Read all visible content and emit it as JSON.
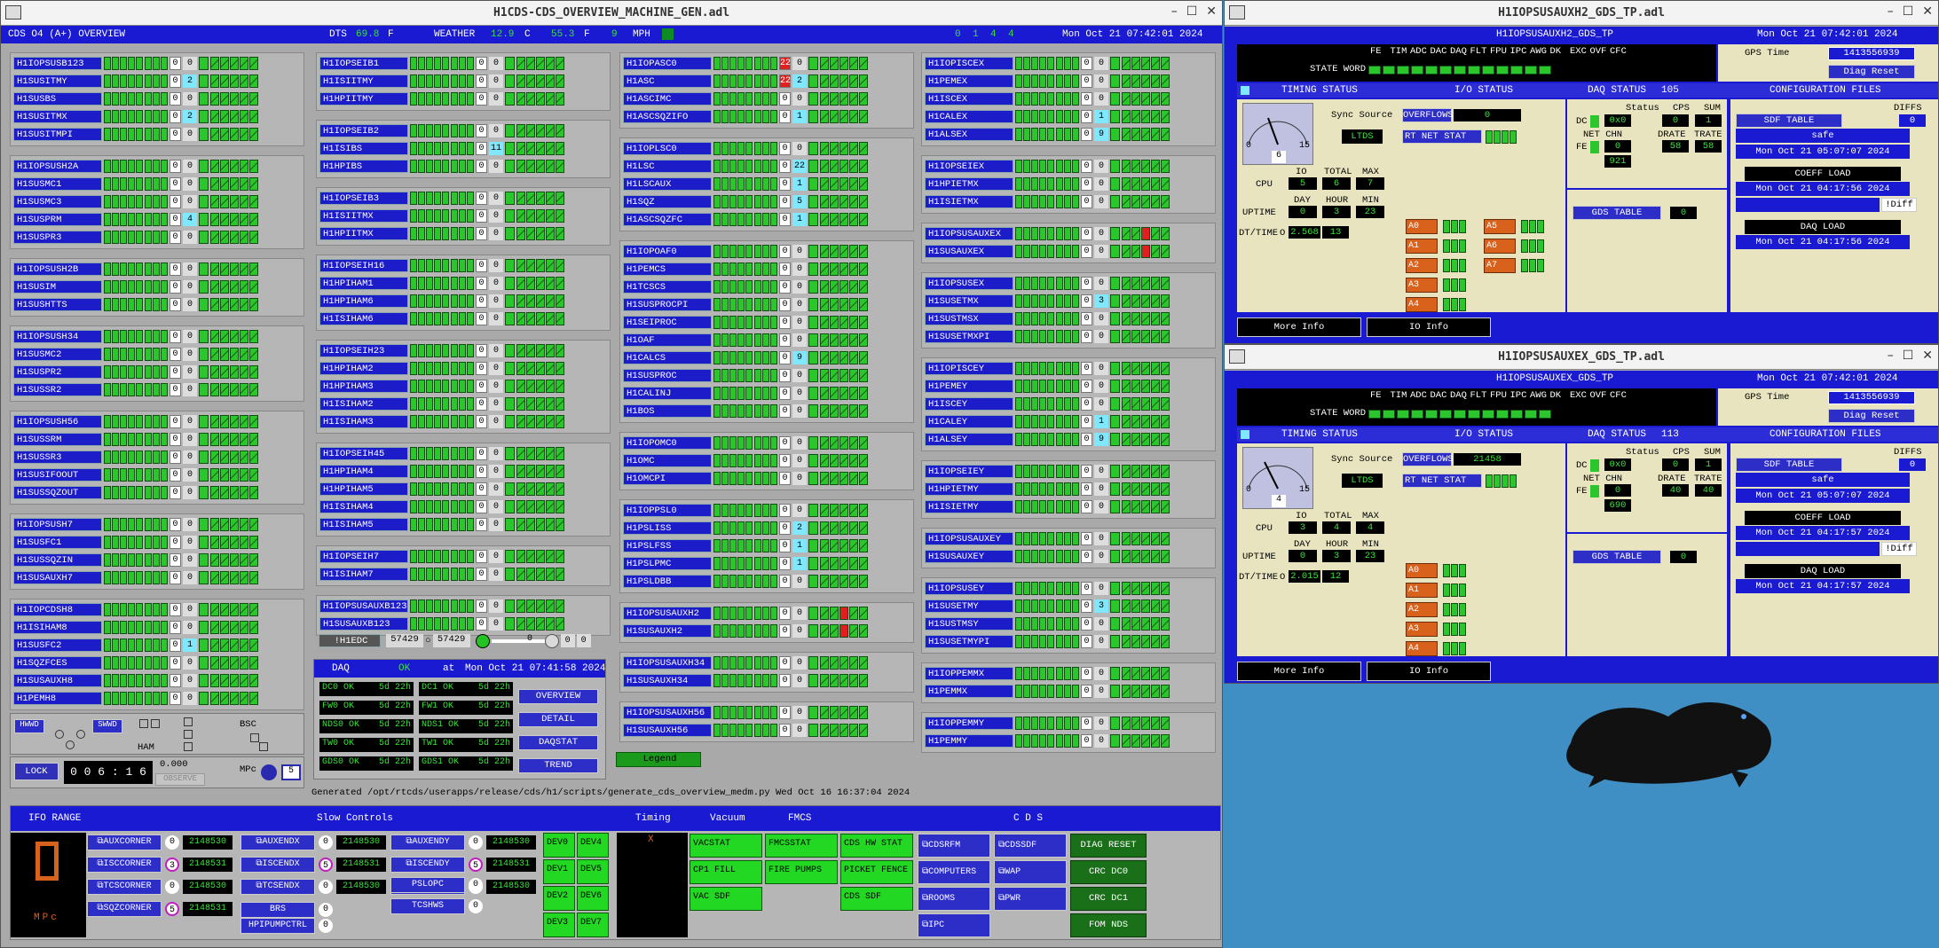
{
  "main": {
    "title": "H1CDS-CDS_OVERVIEW_MACHINE_GEN.adl",
    "header": {
      "left": "CDS O4 (A+) OVERVIEW",
      "dts_label": "DTS",
      "dts_val": "69.8",
      "dts_unit": "F",
      "weather_label": "WEATHER",
      "w1": "12.9",
      "w1u": "C",
      "w2": "55.3",
      "w2u": "F",
      "w3": "9",
      "w3u": "MPH",
      "nums": [
        "0",
        "1",
        "4",
        "4"
      ],
      "time": "Mon Oct 21 07:42:01 2024"
    },
    "col1": [
      [
        {
          "l": "H1IOPSUSB123",
          "v": "0"
        },
        {
          "l": "H1SUSITMY",
          "v": "2",
          "h": true
        },
        {
          "l": "H1SUSBS",
          "v": "0"
        },
        {
          "l": "H1SUSITMX",
          "v": "2",
          "h": true
        },
        {
          "l": "H1SUSITMPI",
          "v": "0"
        }
      ],
      [
        {
          "l": "H1IOPSUSH2A",
          "v": "0"
        },
        {
          "l": "H1SUSMC1",
          "v": "0"
        },
        {
          "l": "H1SUSMC3",
          "v": "0"
        },
        {
          "l": "H1SUSPRM",
          "v": "4",
          "h": true
        },
        {
          "l": "H1SUSPR3",
          "v": "0"
        }
      ],
      [
        {
          "l": "H1IOPSUSH2B",
          "v": "0"
        },
        {
          "l": "H1SUSIM",
          "v": "0"
        },
        {
          "l": "H1SUSHTTS",
          "v": "0"
        }
      ],
      [
        {
          "l": "H1IOPSUSH34",
          "v": "0"
        },
        {
          "l": "H1SUSMC2",
          "v": "0"
        },
        {
          "l": "H1SUSPR2",
          "v": "0"
        },
        {
          "l": "H1SUSSR2",
          "v": "0"
        }
      ],
      [
        {
          "l": "H1IOPSUSH56",
          "v": "0"
        },
        {
          "l": "H1SUSSRM",
          "v": "0"
        },
        {
          "l": "H1SUSSR3",
          "v": "0"
        },
        {
          "l": "H1SUSIFOOUT",
          "v": "0"
        },
        {
          "l": "H1SUSSQZOUT",
          "v": "0"
        }
      ],
      [
        {
          "l": "H1IOPSUSH7",
          "v": "0"
        },
        {
          "l": "H1SUSFC1",
          "v": "0"
        },
        {
          "l": "H1SUSSQZIN",
          "v": "0"
        },
        {
          "l": "H1SUSAUXH7",
          "v": "0"
        }
      ],
      [
        {
          "l": "H1IOPCDSH8",
          "v": "0"
        },
        {
          "l": "H1ISIHAM8",
          "v": "0"
        },
        {
          "l": "H1SUSFC2",
          "v": "1",
          "h": true
        },
        {
          "l": "H1SQZFCES",
          "v": "0"
        },
        {
          "l": "H1SUSAUXH8",
          "v": "0"
        },
        {
          "l": "H1PEMH8",
          "v": "0"
        }
      ]
    ],
    "col2": [
      [
        {
          "l": "H1IOPSEIB1",
          "v": "0"
        },
        {
          "l": "H1ISIITMY",
          "v": "0"
        },
        {
          "l": "H1HPIITMY",
          "v": "0"
        }
      ],
      [
        {
          "l": "H1IOPSEIB2",
          "v": "0"
        },
        {
          "l": "H1ISIBS",
          "v": "11",
          "h": true
        },
        {
          "l": "H1HPIBS",
          "v": "0"
        }
      ],
      [
        {
          "l": "H1IOPSEIB3",
          "v": "0"
        },
        {
          "l": "H1ISIITMX",
          "v": "0"
        },
        {
          "l": "H1HPIITMX",
          "v": "0"
        }
      ],
      [
        {
          "l": "H1IOPSEIH16",
          "v": "0"
        },
        {
          "l": "H1HPIHAM1",
          "v": "0"
        },
        {
          "l": "H1HPIHAM6",
          "v": "0"
        },
        {
          "l": "H1ISIHAM6",
          "v": "0"
        }
      ],
      [
        {
          "l": "H1IOPSEIH23",
          "v": "0"
        },
        {
          "l": "H1HPIHAM2",
          "v": "0"
        },
        {
          "l": "H1HPIHAM3",
          "v": "0"
        },
        {
          "l": "H1ISIHAM2",
          "v": "0"
        },
        {
          "l": "H1ISIHAM3",
          "v": "0"
        }
      ],
      [
        {
          "l": "H1IOPSEIH45",
          "v": "0"
        },
        {
          "l": "H1HPIHAM4",
          "v": "0"
        },
        {
          "l": "H1HPIHAM5",
          "v": "0"
        },
        {
          "l": "H1ISIHAM4",
          "v": "0"
        },
        {
          "l": "H1ISIHAM5",
          "v": "0"
        }
      ],
      [
        {
          "l": "H1IOPSEIH7",
          "v": "0"
        },
        {
          "l": "H1ISIHAM7",
          "v": "0"
        }
      ],
      [
        {
          "l": "H1IOPSUSAUXB123",
          "v": "0"
        },
        {
          "l": "H1SUSAUXB123",
          "v": "0"
        }
      ]
    ],
    "col3": [
      [
        {
          "l": "H1IOPASC0",
          "v": "0",
          "r": "22"
        },
        {
          "l": "H1ASC",
          "v": "2",
          "h": true,
          "r": "22"
        },
        {
          "l": "H1ASCIMC",
          "v": "0"
        },
        {
          "l": "H1ASCSQZIFO",
          "v": "1",
          "h": true
        }
      ],
      [
        {
          "l": "H1IOPLSC0",
          "v": "0"
        },
        {
          "l": "H1LSC",
          "v": "22",
          "h": true
        },
        {
          "l": "H1LSCAUX",
          "v": "1",
          "h": true
        },
        {
          "l": "H1SQZ",
          "v": "5",
          "h": true
        },
        {
          "l": "H1ASCSQZFC",
          "v": "1",
          "h": true
        }
      ],
      [
        {
          "l": "H1IOPOAF0",
          "v": "0"
        },
        {
          "l": "H1PEMCS",
          "v": "0"
        },
        {
          "l": "H1TCSCS",
          "v": "0"
        },
        {
          "l": "H1SUSPROCPI",
          "v": "0"
        },
        {
          "l": "H1SEIPROC",
          "v": "0"
        },
        {
          "l": "H1OAF",
          "v": "0"
        },
        {
          "l": "H1CALCS",
          "v": "9",
          "h": true
        },
        {
          "l": "H1SUSPROC",
          "v": "0"
        },
        {
          "l": "H1CALINJ",
          "v": "0"
        },
        {
          "l": "H1BOS",
          "v": "0"
        }
      ],
      [
        {
          "l": "H1IOPOMC0",
          "v": "0"
        },
        {
          "l": "H1OMC",
          "v": "0"
        },
        {
          "l": "H1OMCPI",
          "v": "0"
        }
      ],
      [
        {
          "l": "H1IOPPSL0",
          "v": "0"
        },
        {
          "l": "H1PSLISS",
          "v": "2",
          "h": true
        },
        {
          "l": "H1PSLFSS",
          "v": "1",
          "h": true
        },
        {
          "l": "H1PSLPMC",
          "v": "1",
          "h": true
        },
        {
          "l": "H1PSLDBB",
          "v": "0"
        }
      ],
      [
        {
          "l": "H1IOPSUSAUXH2",
          "v": "0"
        },
        {
          "l": "H1SUSAUXH2",
          "v": "0"
        }
      ],
      [
        {
          "l": "H1IOPSUSAUXH34",
          "v": "0"
        },
        {
          "l": "H1SUSAUXH34",
          "v": "0"
        }
      ],
      [
        {
          "l": "H1IOPSUSAUXH56",
          "v": "0"
        },
        {
          "l": "H1SUSAUXH56",
          "v": "0"
        }
      ]
    ],
    "col4": [
      [
        {
          "l": "H1IOPISCEX",
          "v": "0"
        },
        {
          "l": "H1PEMEX",
          "v": "0"
        },
        {
          "l": "H1ISCEX",
          "v": "0"
        },
        {
          "l": "H1CALEX",
          "v": "1",
          "h": true
        },
        {
          "l": "H1ALSEX",
          "v": "9",
          "h": true
        }
      ],
      [
        {
          "l": "H1IOPSEIEX",
          "v": "0"
        },
        {
          "l": "H1HPIETMX",
          "v": "0"
        },
        {
          "l": "H1ISIETMX",
          "v": "0"
        }
      ],
      [
        {
          "l": "H1IOPSUSAUXEX",
          "v": "0"
        },
        {
          "l": "H1SUSAUXEX",
          "v": "0"
        }
      ],
      [
        {
          "l": "H1IOPSUSEX",
          "v": "0"
        },
        {
          "l": "H1SUSETMX",
          "v": "3",
          "h": true
        },
        {
          "l": "H1SUSTMSX",
          "v": "0"
        },
        {
          "l": "H1SUSETMXPI",
          "v": "0"
        }
      ],
      [
        {
          "l": "H1IOPISCEY",
          "v": "0"
        },
        {
          "l": "H1PEMEY",
          "v": "0"
        },
        {
          "l": "H1ISCEY",
          "v": "0"
        },
        {
          "l": "H1CALEY",
          "v": "1",
          "h": true
        },
        {
          "l": "H1ALSEY",
          "v": "9",
          "h": true
        }
      ],
      [
        {
          "l": "H1IOPSEIEY",
          "v": "0"
        },
        {
          "l": "H1HPIETMY",
          "v": "0"
        },
        {
          "l": "H1ISIETMY",
          "v": "0"
        }
      ],
      [
        {
          "l": "H1IOPSUSAUXEY",
          "v": "0"
        },
        {
          "l": "H1SUSAUXEY",
          "v": "0"
        }
      ],
      [
        {
          "l": "H1IOPSUSEY",
          "v": "0"
        },
        {
          "l": "H1SUSETMY",
          "v": "3",
          "h": true
        },
        {
          "l": "H1SUSTMSY",
          "v": "0"
        },
        {
          "l": "H1SUSETMYPI",
          "v": "0"
        }
      ],
      [
        {
          "l": "H1IOPPEMMX",
          "v": "0"
        },
        {
          "l": "H1PEMMX",
          "v": "0"
        }
      ],
      [
        {
          "l": "H1IOPPEMMY",
          "v": "0"
        },
        {
          "l": "H1PEMMY",
          "v": "0"
        }
      ]
    ],
    "edc": {
      "label": "!H1EDC",
      "v1": "57429",
      "v2": "57429",
      "n1": "0",
      "n2": "0",
      "n3": "0"
    },
    "daq": {
      "label": "DAQ",
      "ok": "OK",
      "at": "at",
      "time": "Mon Oct 21 07:41:58 2024",
      "items": [
        [
          "DC0 OK",
          "5d 22h"
        ],
        [
          "DC1 OK",
          "5d 22h"
        ],
        [
          "FW0 OK",
          "5d 22h"
        ],
        [
          "FW1 OK",
          "5d 22h"
        ],
        [
          "NDS0 OK",
          "5d 22h"
        ],
        [
          "NDS1 OK",
          "5d 22h"
        ],
        [
          "TW0 OK",
          "5d 22h"
        ],
        [
          "TW1 OK",
          "5d 22h"
        ],
        [
          "GDS0 OK",
          "5d 22h"
        ],
        [
          "GDS1 OK",
          "5d 22h"
        ]
      ],
      "buttons": [
        "OVERVIEW",
        "DETAIL",
        "DAQSTAT",
        "TREND"
      ]
    },
    "legend": "Legend",
    "left_bottom": {
      "hwwd": "HWWD",
      "swwd": "SWWD",
      "ham": "HAM",
      "bsc": "BSC",
      "lock": "LOCK",
      "timer": "0 0 6 : 1 6",
      "mpc_val": "0.000",
      "mpc": "MPc",
      "observe": "OBSERVE",
      "num": "5"
    },
    "generated": "Generated /opt/rtcds/userapps/release/cds/h1/scripts/generate_cds_overview_medm.py Wed Oct 16 16:37:04 2024",
    "bottom": {
      "headers": [
        "IFO RANGE",
        "Slow Controls",
        "Timing",
        "Vacuum",
        "FMCS",
        "C D S"
      ],
      "ifo_digit": "0",
      "ifo_unit": "MPc",
      "slow": [
        [
          {
            "b": "AUXCORNER",
            "n": "0",
            "v": "2148530"
          },
          {
            "b": "AUXENDX",
            "n": "0",
            "v": "2148530"
          },
          {
            "b": "AUXENDY",
            "n": "0",
            "v": "2148530"
          }
        ],
        [
          {
            "b": "ISCCORNER",
            "n": "3",
            "v": "2148531"
          },
          {
            "b": "ISCENDX",
            "n": "5",
            "v": "2148531"
          },
          {
            "b": "ISCENDY",
            "n": "5",
            "v": "2148531"
          }
        ],
        [
          {
            "b": "TCSCORNER",
            "n": "0",
            "v": "2148530"
          },
          {
            "b": "TCSENDX",
            "n": "0",
            "v": "2148530"
          },
          {
            "b": "TCSENDY",
            "n": "0",
            "v": "2148530"
          }
        ],
        [
          {
            "b": "SQZCORNER",
            "n": "5",
            "v": "2148531"
          }
        ]
      ],
      "slow_extra": [
        {
          "b": "BRS",
          "n": "0"
        },
        {
          "b": "HPIPUMPCTRL",
          "n": "0"
        },
        {
          "b": "PSLOPC",
          "n": "0"
        },
        {
          "b": "TCSHWS",
          "n": "0"
        }
      ],
      "dev": [
        "DEV0",
        "DEV4",
        "DEV1",
        "DEV5",
        "DEV2",
        "DEV6",
        "DEV3",
        "DEV7"
      ],
      "timing_x": "X",
      "vacuum": [
        "VACSTAT",
        "CP1 FILL",
        "VAC SDF"
      ],
      "fmcs": [
        "FMCSSTAT",
        "FIRE PUMPS"
      ],
      "cds_hw": [
        "CDS HW STAT",
        "PICKET FENCE",
        "CDS SDF"
      ],
      "cds_blue": [
        "CDSRFM",
        "CDSSDF",
        "COMPUTERS",
        "WAP",
        "ROOMS",
        "PWR",
        "IPC"
      ],
      "cds_green": [
        "DIAG RESET",
        "CRC DC0",
        "CRC DC1",
        "FOM NDS"
      ]
    }
  },
  "gds": [
    {
      "title": "H1IOPSUSAUXH2_GDS_TP.adl",
      "name": "H1IOPSUSAUXH2_GDS_TP",
      "time": "Mon Oct 21 07:42:01 2024",
      "bits": [
        "FE",
        "TIM",
        "ADC",
        "DAC",
        "DAQ",
        "FLT",
        "FPU",
        "IPC",
        "AWG",
        "DK",
        "EXC",
        "OVF",
        "CFC"
      ],
      "state_word": "STATE WORD",
      "gps_label": "GPS Time",
      "gps": "1413556939",
      "diag_reset": "Diag Reset",
      "timing": "TIMING STATUS",
      "io": "I/O STATUS",
      "daq_status": "DAQ STATUS",
      "daq_num": "105",
      "config": "CONFIGURATION FILES",
      "sync_label": "Sync Source",
      "sync": "LTDS",
      "overflows": "OVERFLOWS",
      "overflow_val": "0",
      "rtnet": "RT NET STAT",
      "status": "Status",
      "cps": "CPS",
      "sum": "SUM",
      "dc": "DC",
      "fe": "FE",
      "status_val": "0x0",
      "cps_val": "0",
      "sum_val": "1",
      "netchn": "NET CHN",
      "drate": "DRATE",
      "trate": "TRATE",
      "netchn_val": "0",
      "drate_val": "58",
      "trate_val": "58",
      "extra": "921",
      "gauge_val": "6",
      "gauge_min": "0",
      "gauge_max": "15",
      "cpu": "CPU",
      "io_l": "IO",
      "total": "TOTAL",
      "max": "MAX",
      "cpu_vals": [
        "5",
        "6",
        "7"
      ],
      "uptime": "UPTIME",
      "day": "DAY",
      "hour": "HOUR",
      "min": "MIN",
      "up_vals": [
        "0",
        "3",
        "23"
      ],
      "dt": "DT/TIME",
      "dt_o": "O",
      "dt_vals": [
        "2.568",
        "13"
      ],
      "adc": [
        "A0",
        "A1",
        "A2",
        "A3",
        "A4"
      ],
      "adc2": [
        "A5",
        "A6",
        "A7"
      ],
      "gds_table": "GDS TABLE",
      "gds_table_val": "0",
      "sdf_table": "SDF TABLE",
      "diffs": "DIFFS",
      "diffs_val": "0",
      "safe": "safe",
      "sdf_time": "Mon Oct 21 05:07:07 2024",
      "coeff": "COEFF LOAD",
      "coeff_time": "Mon Oct 21 04:17:56 2024",
      "diff": "!Diff",
      "daqload": "DAQ LOAD",
      "daqload_time": "Mon Oct 21 04:17:56 2024",
      "more": "More Info",
      "ioinfo": "IO Info"
    },
    {
      "title": "H1IOPSUSAUXEX_GDS_TP.adl",
      "name": "H1IOPSUSAUXEX_GDS_TP",
      "time": "Mon Oct 21 07:42:01 2024",
      "bits": [
        "FE",
        "TIM",
        "ADC",
        "DAC",
        "DAQ",
        "FLT",
        "FPU",
        "IPC",
        "AWG",
        "DK",
        "EXC",
        "OVF",
        "CFC"
      ],
      "state_word": "STATE WORD",
      "gps_label": "GPS Time",
      "gps": "1413556939",
      "diag_reset": "Diag Reset",
      "timing": "TIMING STATUS",
      "io": "I/O STATUS",
      "daq_status": "DAQ STATUS",
      "daq_num": "113",
      "config": "CONFIGURATION FILES",
      "sync_label": "Sync Source",
      "sync": "LTDS",
      "overflows": "OVERFLOWS",
      "overflow_val": "21458",
      "rtnet": "RT NET STAT",
      "status": "Status",
      "cps": "CPS",
      "sum": "SUM",
      "dc": "DC",
      "fe": "FE",
      "status_val": "0x0",
      "cps_val": "0",
      "sum_val": "1",
      "netchn": "NET CHN",
      "drate": "DRATE",
      "trate": "TRATE",
      "netchn_val": "0",
      "drate_val": "40",
      "trate_val": "40",
      "extra": "690",
      "gauge_val": "4",
      "gauge_min": "0",
      "gauge_max": "15",
      "cpu": "CPU",
      "io_l": "IO",
      "total": "TOTAL",
      "max": "MAX",
      "cpu_vals": [
        "3",
        "4",
        "4"
      ],
      "uptime": "UPTIME",
      "day": "DAY",
      "hour": "HOUR",
      "min": "MIN",
      "up_vals": [
        "0",
        "3",
        "23"
      ],
      "dt": "DT/TIME",
      "dt_o": "O",
      "dt_vals": [
        "2.015",
        "12"
      ],
      "adc": [
        "A0",
        "A1",
        "A2",
        "A3",
        "A4"
      ],
      "adc2": [],
      "gds_table": "GDS TABLE",
      "gds_table_val": "0",
      "sdf_table": "SDF TABLE",
      "diffs": "DIFFS",
      "diffs_val": "0",
      "safe": "safe",
      "sdf_time": "Mon Oct 21 05:07:07 2024",
      "coeff": "COEFF LOAD",
      "coeff_time": "Mon Oct 21 04:17:57 2024",
      "diff": "!Diff",
      "daqload": "DAQ LOAD",
      "daqload_time": "Mon Oct 21 04:17:57 2024",
      "more": "More Info",
      "ioinfo": "IO Info"
    }
  ]
}
